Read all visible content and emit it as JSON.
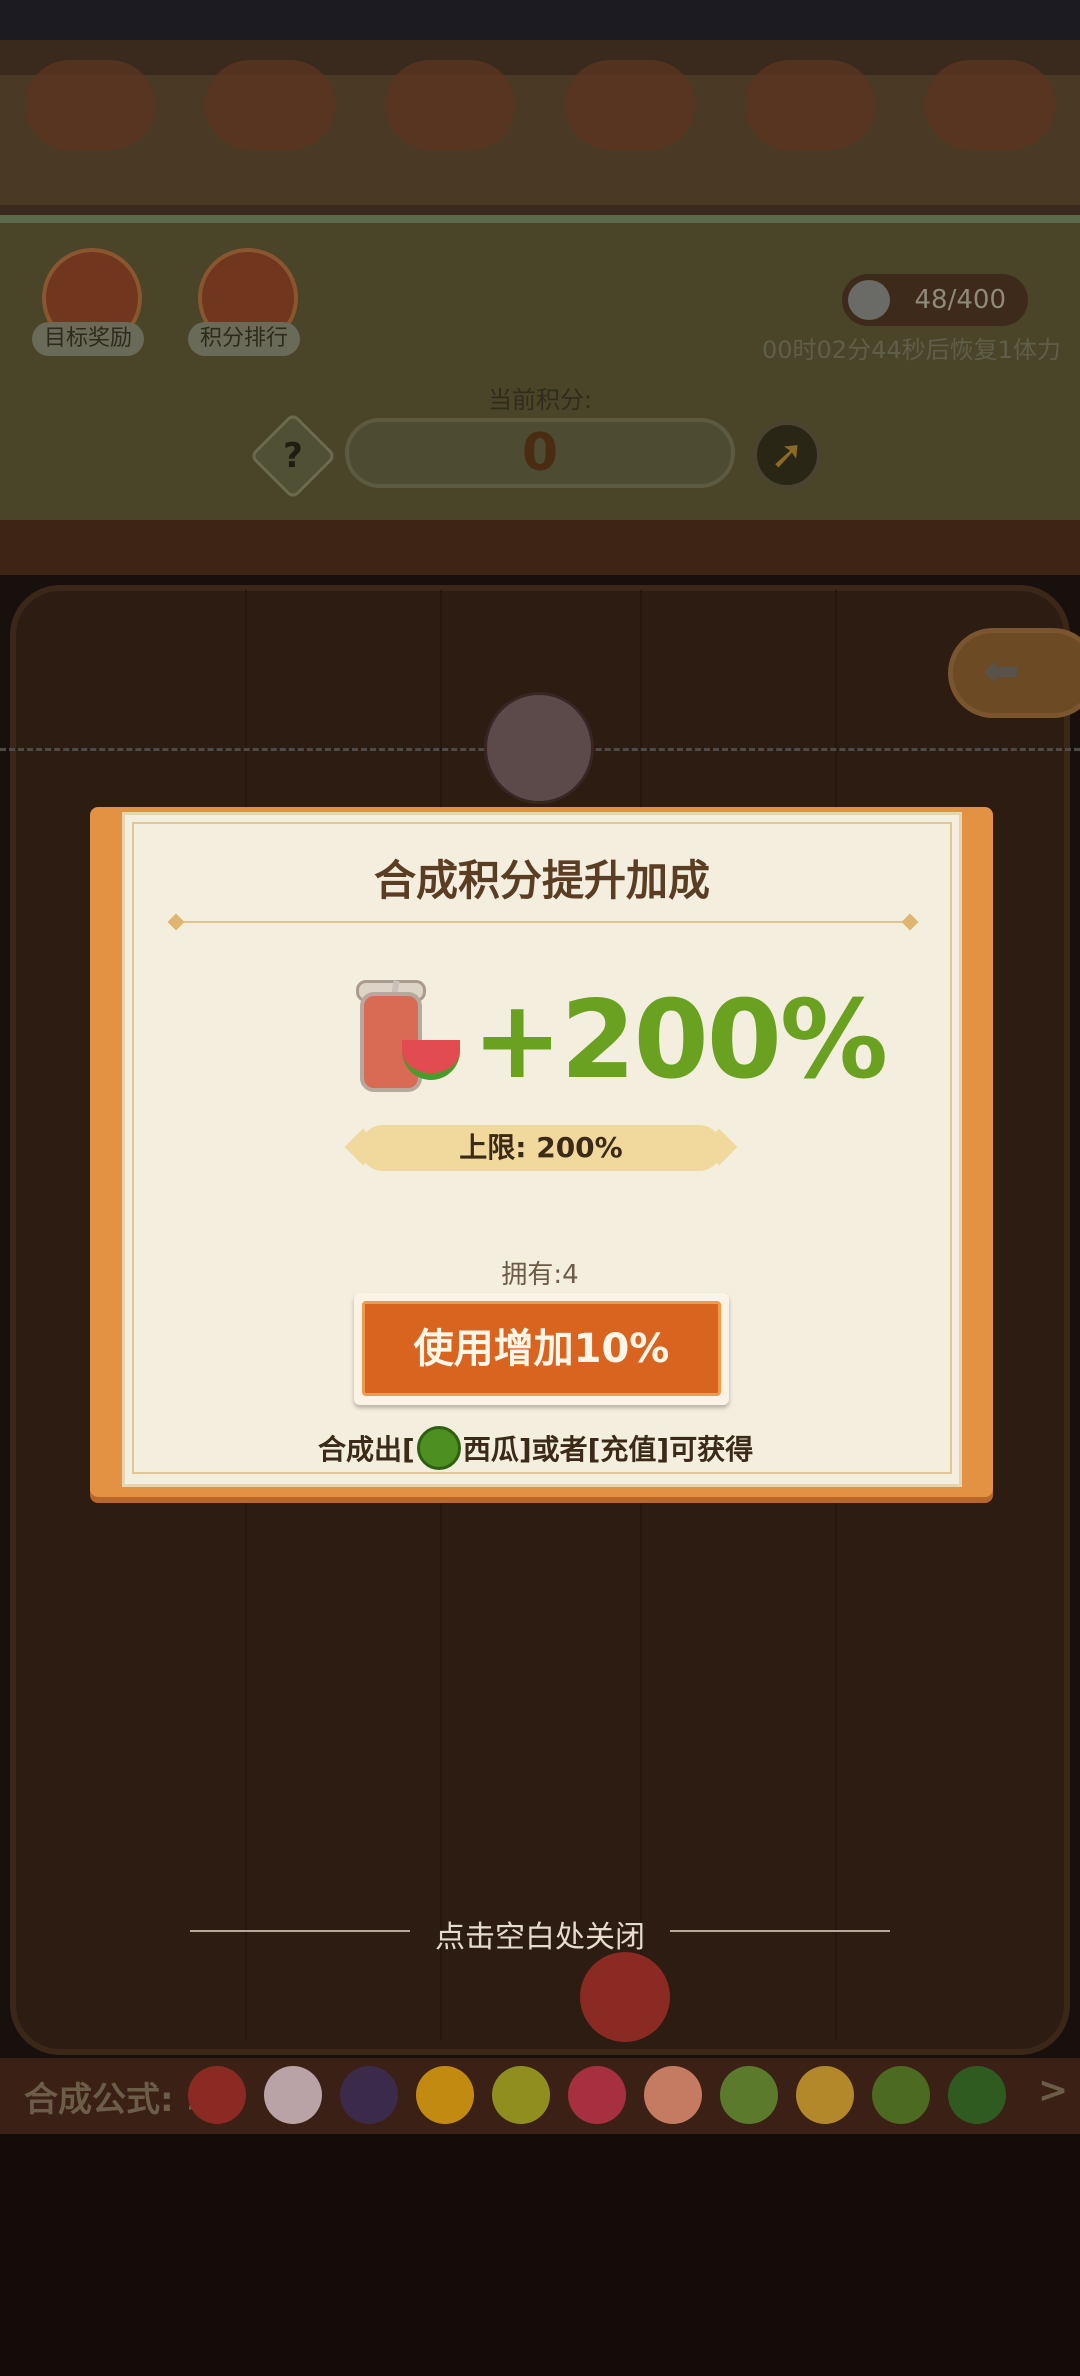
{
  "hud": {
    "target_reward_label": "目标奖励",
    "ranking_label": "积分排行",
    "energy_text": "48/400",
    "recover_text": "00时02分44秒后恢复1体力",
    "score_title": "当前积分:",
    "score_value": "0",
    "help_symbol": "?"
  },
  "dialog": {
    "title": "合成积分提升加成",
    "bonus_text": "+200%",
    "limit_text": "上限: 200%",
    "owned_text": "拥有:4",
    "use_button_label": "使用增加10%",
    "hint_prefix": "合成出[",
    "hint_suffix": "西瓜]或者[充值]可获得"
  },
  "close_hint": "点击空白处关闭",
  "formula": {
    "label": "合成公式:",
    "arrow": ">",
    "fruits": [
      {
        "name": "cherry",
        "color": "#8a2a22"
      },
      {
        "name": "lychee",
        "color": "#b9a3a6"
      },
      {
        "name": "grape",
        "color": "#3c2a4a"
      },
      {
        "name": "orange",
        "color": "#c38a12"
      },
      {
        "name": "lemon",
        "color": "#8f8e1f"
      },
      {
        "name": "apple",
        "color": "#a63040"
      },
      {
        "name": "peach",
        "color": "#c57a62"
      },
      {
        "name": "kiwi",
        "color": "#5c7a2c"
      },
      {
        "name": "pineapple",
        "color": "#b2882a"
      },
      {
        "name": "melon",
        "color": "#4c6a20"
      },
      {
        "name": "watermelon",
        "color": "#2f5a20"
      }
    ]
  },
  "colors": {
    "accent_green": "#6aa121",
    "button_orange": "#d9641f",
    "frame_orange": "#e39142"
  }
}
